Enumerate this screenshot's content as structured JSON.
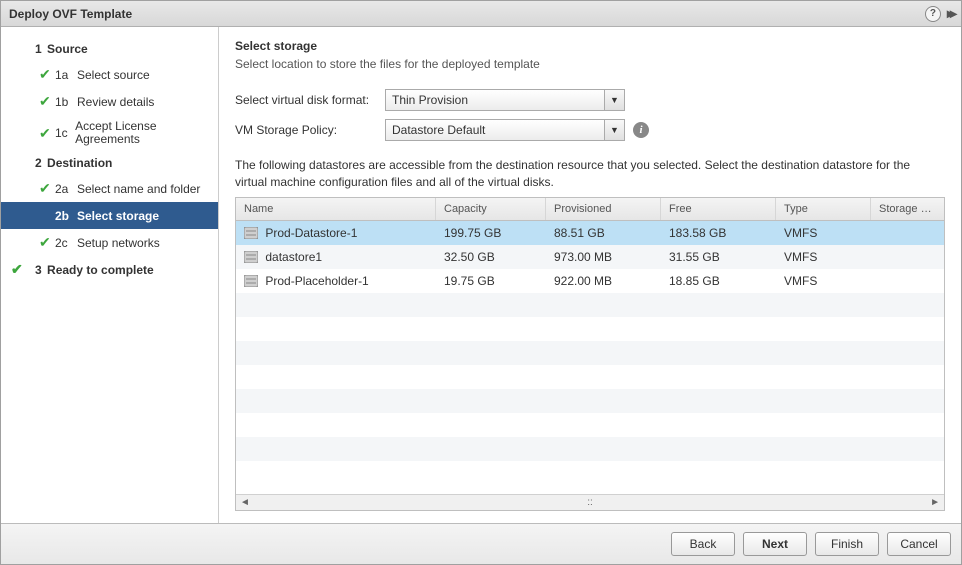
{
  "title": "Deploy OVF Template",
  "sidebar": {
    "steps": [
      {
        "num": "1",
        "label": "Source",
        "head": true,
        "done": false
      },
      {
        "num": "1a",
        "label": "Select source",
        "done": true
      },
      {
        "num": "1b",
        "label": "Review details",
        "done": true
      },
      {
        "num": "1c",
        "label": "Accept License Agreements",
        "done": true
      },
      {
        "num": "2",
        "label": "Destination",
        "head": true,
        "done": false
      },
      {
        "num": "2a",
        "label": "Select name and folder",
        "done": true
      },
      {
        "num": "2b",
        "label": "Select storage",
        "done": false,
        "active": true
      },
      {
        "num": "2c",
        "label": "Setup networks",
        "done": true
      },
      {
        "num": "3",
        "label": "Ready to complete",
        "head": true,
        "done": true
      }
    ]
  },
  "page": {
    "heading": "Select storage",
    "subheading": "Select location to store the files for the deployed template"
  },
  "form": {
    "disk_format_label": "Select virtual disk format:",
    "disk_format_value": "Thin Provision",
    "storage_policy_label": "VM Storage Policy:",
    "storage_policy_value": "Datastore Default"
  },
  "description": "The following datastores are accessible from the destination resource that you selected. Select the destination datastore for the virtual machine configuration files and all of the virtual disks.",
  "table": {
    "columns": [
      "Name",
      "Capacity",
      "Provisioned",
      "Free",
      "Type",
      "Storage DRS"
    ],
    "rows": [
      {
        "name": "Prod-Datastore-1",
        "capacity": "199.75 GB",
        "provisioned": "88.51 GB",
        "free": "183.58 GB",
        "type": "VMFS",
        "drs": "",
        "selected": true
      },
      {
        "name": "datastore1",
        "capacity": "32.50 GB",
        "provisioned": "973.00 MB",
        "free": "31.55 GB",
        "type": "VMFS",
        "drs": ""
      },
      {
        "name": "Prod-Placeholder-1",
        "capacity": "19.75 GB",
        "provisioned": "922.00 MB",
        "free": "18.85 GB",
        "type": "VMFS",
        "drs": ""
      }
    ]
  },
  "buttons": {
    "back": "Back",
    "next": "Next",
    "finish": "Finish",
    "cancel": "Cancel"
  }
}
